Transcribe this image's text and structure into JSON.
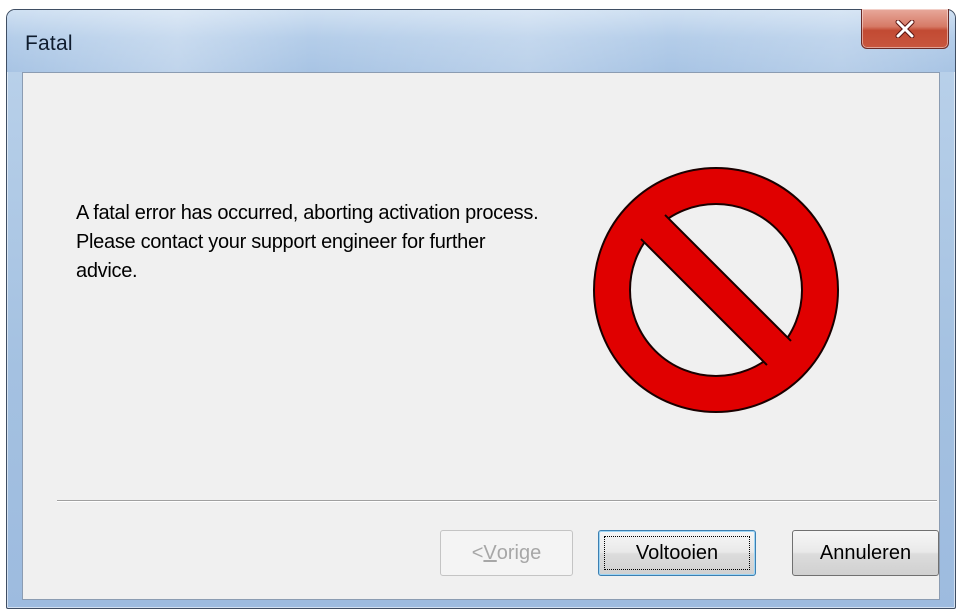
{
  "window": {
    "title": "Fatal",
    "close_glyph": "✕"
  },
  "dialog": {
    "message": "A fatal error has occurred, aborting activation process. Please contact your support engineer for further advice.",
    "icon": "prohibition-stop-icon",
    "icon_color": "#e00000"
  },
  "buttons": {
    "prev": {
      "prefix": "< ",
      "mnemonic": "V",
      "rest": "orige",
      "enabled": false
    },
    "finish": {
      "label": "Voltooien",
      "default": true
    },
    "cancel": {
      "label": "Annuleren"
    }
  }
}
